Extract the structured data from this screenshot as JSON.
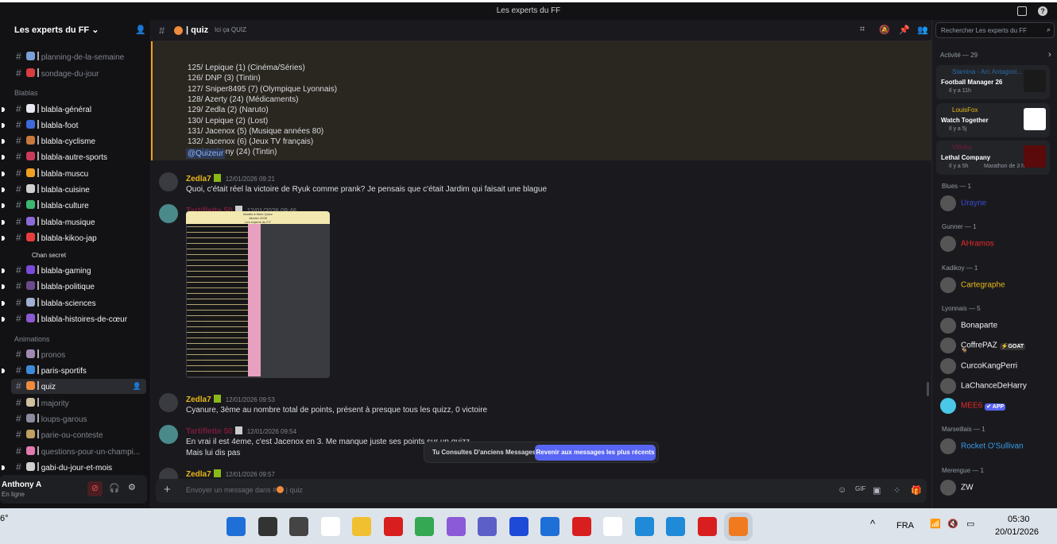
{
  "window": {
    "title": "Les experts du FF"
  },
  "server": {
    "name": "Les experts du FF"
  },
  "channels": [
    {
      "label": "planning-de-la-semaine",
      "muted": true,
      "color": "#7aa0d8"
    },
    {
      "label": "sondage-du-jour",
      "muted": true,
      "color": "#d83c3e",
      "icon": "?"
    },
    {
      "category": "Blablas"
    },
    {
      "label": "blabla-général",
      "unread": true,
      "color": "#e8e8f0"
    },
    {
      "label": "blabla-foot",
      "unread": true,
      "color": "#3c6ad8"
    },
    {
      "label": "blabla-cyclisme",
      "unread": true,
      "color": "#c87a3c"
    },
    {
      "label": "blabla-autre-sports",
      "unread": true,
      "color": "#c83c5a"
    },
    {
      "label": "blabla-muscu",
      "unread": true,
      "color": "#f0a020"
    },
    {
      "label": "blabla-cuisine",
      "unread": true,
      "color": "#d0d0d0"
    },
    {
      "label": "blabla-culture",
      "unread": true,
      "color": "#3cb870"
    },
    {
      "label": "blabla-musique",
      "unread": true,
      "color": "#8a6ad8"
    },
    {
      "label": "blabla-kikoo-jap",
      "unread": true,
      "color": "#e83c3c"
    },
    {
      "thread": "Chan secret"
    },
    {
      "label": "blabla-gaming",
      "unread": true,
      "color": "#7a4ad8"
    },
    {
      "label": "blabla-politique",
      "unread": true,
      "color": "#6a4a8a"
    },
    {
      "label": "blabla-sciences",
      "unread": true,
      "color": "#a0b0d0"
    },
    {
      "label": "blabla-histoires-de-cœur",
      "unread": true,
      "color": "#8a5ad0"
    },
    {
      "category": "Animations"
    },
    {
      "label": "pronos",
      "muted": true,
      "color": "#a08ab0"
    },
    {
      "label": "paris-sportifs",
      "unread": true,
      "color": "#3c8ad8"
    },
    {
      "label": "quiz",
      "selected": true,
      "color": "#f08a3c"
    },
    {
      "label": "majority",
      "muted": true,
      "color": "#d0c0a0"
    },
    {
      "label": "loups-garous",
      "muted": true,
      "color": "#8a8aa0"
    },
    {
      "label": "parie-ou-conteste",
      "muted": true,
      "color": "#c0a060"
    },
    {
      "label": "questions-pour-un-champi...",
      "muted": true,
      "color": "#e07ab0"
    },
    {
      "label": "gabi-du-jour-et-mois",
      "unread": true,
      "color": "#d0d0d0"
    }
  ],
  "user": {
    "name": "Anthony A",
    "status": "En ligne"
  },
  "chat": {
    "channel": "quiz",
    "topic": "Ici ça QUIZ",
    "input_placeholder": "Envoyer un message dans #",
    "input_channel": "quiz",
    "quote_lines": [
      "125/ Lepique (1) (Cinéma/Séries)",
      "126/ DNP (3) (Tintin)",
      "127/ Sniper8495 (7) (Olympique Lyonnais)",
      "128/ Azerty (24) (Médicaments)",
      "129/ Zedla (2) (Naruto)",
      "130/ Lepique (2) (Lost)",
      "131/ Jacenox (5) (Musique années 80)",
      "132/ Jacenox (6) (Jeux TV français)",
      "133/ Anthony (24) (Tintin)"
    ],
    "mention": "@Quizeur",
    "messages": [
      {
        "author": "Zedla7",
        "color": "#e8b818",
        "time": "12/01/2026 09:21",
        "lines": [
          "Quoi, c'était réel la victoire de Ryuk comme prank? Je pensais que c'était Jardim qui faisait une blague"
        ]
      },
      {
        "author": "Tartiflette 50",
        "color": "#7a1a3a",
        "time": "12/01/2026 09:46",
        "lines": [],
        "image": true
      },
      {
        "author": "Zedla7",
        "color": "#e8b818",
        "time": "12/01/2026 09:53",
        "lines": [
          "Cyanure, 3ème au nombre total de points, présent à presque tous les quizz, 0 victoire"
        ]
      },
      {
        "author": "Tartiflette 50",
        "color": "#7a1a3a",
        "time": "12/01/2026 09:54",
        "lines": [
          "En vrai il est 4eme, c'est Jacenox en 3. Me manque juste ses points sur un quizz",
          "Mais lui dis pas"
        ]
      },
      {
        "author": "Zedla7",
        "color": "#e8b818",
        "time": "12/01/2026 09:57",
        "lines": []
      }
    ],
    "old_notice": "Tu Consultes D'anciens Messages",
    "jump_button": "Revenir aux messages les plus récents",
    "image_title": [
      "Mardis à thèm Quizz",
      "Janvier 2026",
      "Les experts du F.F"
    ]
  },
  "members": {
    "search_placeholder": "Rechercher Les experts du FF",
    "activity_label": "Activité — 29",
    "activities": [
      {
        "user": "Stamina - Arc Antagoni...",
        "color": "#2a6aa8",
        "game": "Football Manager 26",
        "meta": "Il y a 11h",
        "thumb": "#1a1a1a"
      },
      {
        "user": "LouisFox",
        "color": "#e8b818",
        "game": "Watch Together",
        "meta": "Il y a 5j",
        "thumb": "#ffffff"
      },
      {
        "user": "Vitinha",
        "color": "#7a1a3a",
        "game": "Lethal Company",
        "meta": "Il y a 5h",
        "meta2": "Marathon de 3 h",
        "thumb": "#5a0a0a"
      }
    ],
    "groups": [
      {
        "label": "Blues — 1",
        "members": [
          {
            "name": "Urayne",
            "color": "#3a4ad8"
          }
        ]
      },
      {
        "label": "Gunner — 1",
        "members": [
          {
            "name": "AHramos",
            "color": "#e8282a"
          }
        ]
      },
      {
        "label": "Kadikoy — 1",
        "members": [
          {
            "name": "Cartegraphe",
            "color": "#e8b818"
          }
        ]
      },
      {
        "label": "Lyonnais — 5",
        "members": [
          {
            "name": "Bonaparte",
            "color": "#f2f3f5"
          },
          {
            "name": "CoffrePAZ",
            "color": "#f2f3f5",
            "badge": "⚡GOAT",
            "sub": "🐐"
          },
          {
            "name": "CurcoKangPerri",
            "color": "#f2f3f5"
          },
          {
            "name": "LaChanceDeHarry",
            "color": "#f2f3f5"
          },
          {
            "name": "MEE6",
            "color": "#e8282a",
            "badge": "✔ APP",
            "app": true
          }
        ]
      },
      {
        "label": "Marseillais — 1",
        "members": [
          {
            "name": "Rocket O'Sullivan",
            "color": "#3a9ae8"
          }
        ]
      },
      {
        "label": "Merengue — 1",
        "members": [
          {
            "name": "ZW",
            "color": "#f2f3f5"
          }
        ]
      }
    ]
  },
  "taskbar": {
    "weather": "6°",
    "lang": "FRA",
    "time": "05:30",
    "date": "20/01/2026"
  }
}
